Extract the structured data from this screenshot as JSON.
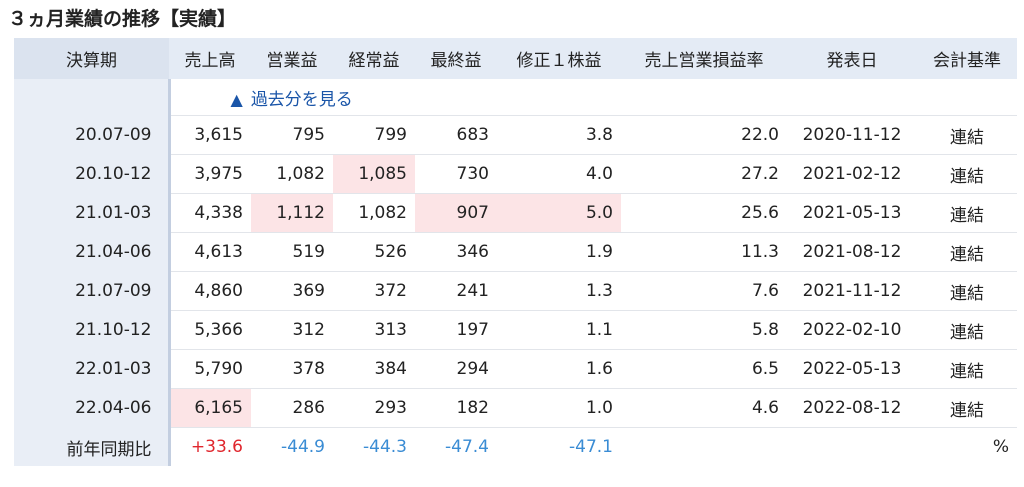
{
  "title": "３ヵ月業績の推移【実績】",
  "headers": [
    "決算期",
    "売上高",
    "営業益",
    "経常益",
    "最終益",
    "修正１株益",
    "売上営業損益率",
    "発表日",
    "会計基準"
  ],
  "more_link": {
    "arrow": "▲",
    "label": "過去分を見る"
  },
  "rows": [
    {
      "period": "20.07-09",
      "sales": "3,615",
      "op": "795",
      "ord": "799",
      "net": "683",
      "eps": "3.8",
      "margin": "22.0",
      "date": "2020-11-12",
      "std": "連結",
      "hl": []
    },
    {
      "period": "20.10-12",
      "sales": "3,975",
      "op": "1,082",
      "ord": "1,085",
      "net": "730",
      "eps": "4.0",
      "margin": "27.2",
      "date": "2021-02-12",
      "std": "連結",
      "hl": [
        "ord"
      ]
    },
    {
      "period": "21.01-03",
      "sales": "4,338",
      "op": "1,112",
      "ord": "1,082",
      "net": "907",
      "eps": "5.0",
      "margin": "25.6",
      "date": "2021-05-13",
      "std": "連結",
      "hl": [
        "op",
        "net",
        "eps"
      ]
    },
    {
      "period": "21.04-06",
      "sales": "4,613",
      "op": "519",
      "ord": "526",
      "net": "346",
      "eps": "1.9",
      "margin": "11.3",
      "date": "2021-08-12",
      "std": "連結",
      "hl": []
    },
    {
      "period": "21.07-09",
      "sales": "4,860",
      "op": "369",
      "ord": "372",
      "net": "241",
      "eps": "1.3",
      "margin": "7.6",
      "date": "2021-11-12",
      "std": "連結",
      "hl": []
    },
    {
      "period": "21.10-12",
      "sales": "5,366",
      "op": "312",
      "ord": "313",
      "net": "197",
      "eps": "1.1",
      "margin": "5.8",
      "date": "2022-02-10",
      "std": "連結",
      "hl": []
    },
    {
      "period": "22.01-03",
      "sales": "5,790",
      "op": "378",
      "ord": "384",
      "net": "294",
      "eps": "1.6",
      "margin": "6.5",
      "date": "2022-05-13",
      "std": "連結",
      "hl": []
    },
    {
      "period": "22.04-06",
      "sales": "6,165",
      "op": "286",
      "ord": "293",
      "net": "182",
      "eps": "1.0",
      "margin": "4.6",
      "date": "2022-08-12",
      "std": "連結",
      "hl": [
        "sales"
      ]
    }
  ],
  "yoy": {
    "label": "前年同期比",
    "sales": "+33.6",
    "op": "-44.9",
    "ord": "-44.3",
    "net": "-47.4",
    "eps": "-47.1",
    "margin": "",
    "date": "",
    "std": "%"
  },
  "colors": {
    "positive": "#e0262d",
    "negative": "#3a8cd4",
    "highlight": "#fce4e6",
    "header_bg": "#e4ebf5",
    "link": "#1a55a8"
  }
}
